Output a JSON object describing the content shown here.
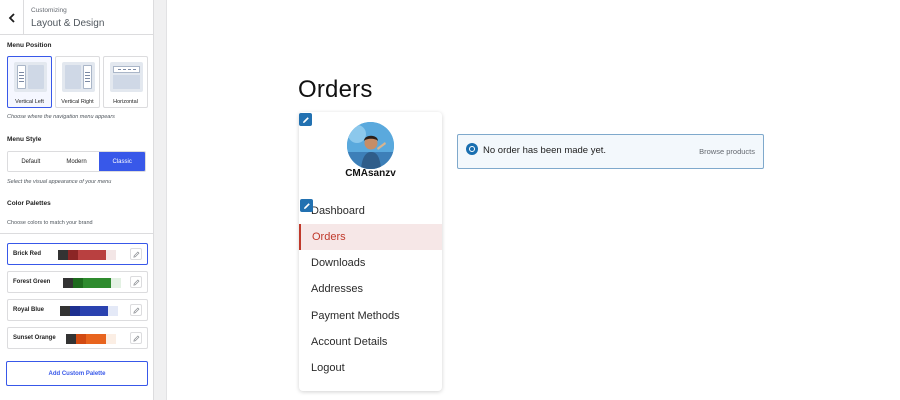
{
  "customizer": {
    "kicker": "Customizing",
    "title": "Layout & Design",
    "menu_position": {
      "title": "Menu Position",
      "options": [
        {
          "label": "Vertical Left",
          "selected": true
        },
        {
          "label": "Vertical Right",
          "selected": false
        },
        {
          "label": "Horizontal",
          "selected": false
        }
      ],
      "hint": "Choose where the navigation menu appears"
    },
    "menu_style": {
      "title": "Menu Style",
      "options": [
        {
          "label": "Default",
          "active": false
        },
        {
          "label": "Modern",
          "active": false
        },
        {
          "label": "Classic",
          "active": true
        }
      ],
      "hint": "Select the visual appearance of your menu"
    },
    "color_palettes": {
      "title": "Color Palettes",
      "hint": "Choose colors to match your brand",
      "palettes": [
        {
          "name": "Brick Red",
          "selected": true,
          "colors": [
            "#333333",
            "#8b2525",
            "#b94040",
            "#f3e6e6"
          ]
        },
        {
          "name": "Forest Green",
          "selected": false,
          "colors": [
            "#333333",
            "#1e6b1e",
            "#2e8b2e",
            "#e3f1e3"
          ]
        },
        {
          "name": "Royal Blue",
          "selected": false,
          "colors": [
            "#333333",
            "#1d2f8f",
            "#2a42b0",
            "#e4e9f7"
          ]
        },
        {
          "name": "Sunset Orange",
          "selected": false,
          "colors": [
            "#333333",
            "#d24a12",
            "#e8641e",
            "#fbeee4"
          ]
        }
      ],
      "add_label": "Add Custom Palette"
    },
    "accent_color": "#3858e9"
  },
  "preview": {
    "page_title": "Orders",
    "account": {
      "username": "CMAsanzv",
      "nav": [
        {
          "label": "Dashboard",
          "active": false
        },
        {
          "label": "Orders",
          "active": true
        },
        {
          "label": "Downloads",
          "active": false
        },
        {
          "label": "Addresses",
          "active": false
        },
        {
          "label": "Payment Methods",
          "active": false
        },
        {
          "label": "Account Details",
          "active": false
        },
        {
          "label": "Logout",
          "active": false
        }
      ]
    },
    "notice": {
      "message": "No order has been made yet.",
      "link": "Browse products",
      "icon": "info-icon"
    },
    "brand_color": "#c0392b"
  }
}
